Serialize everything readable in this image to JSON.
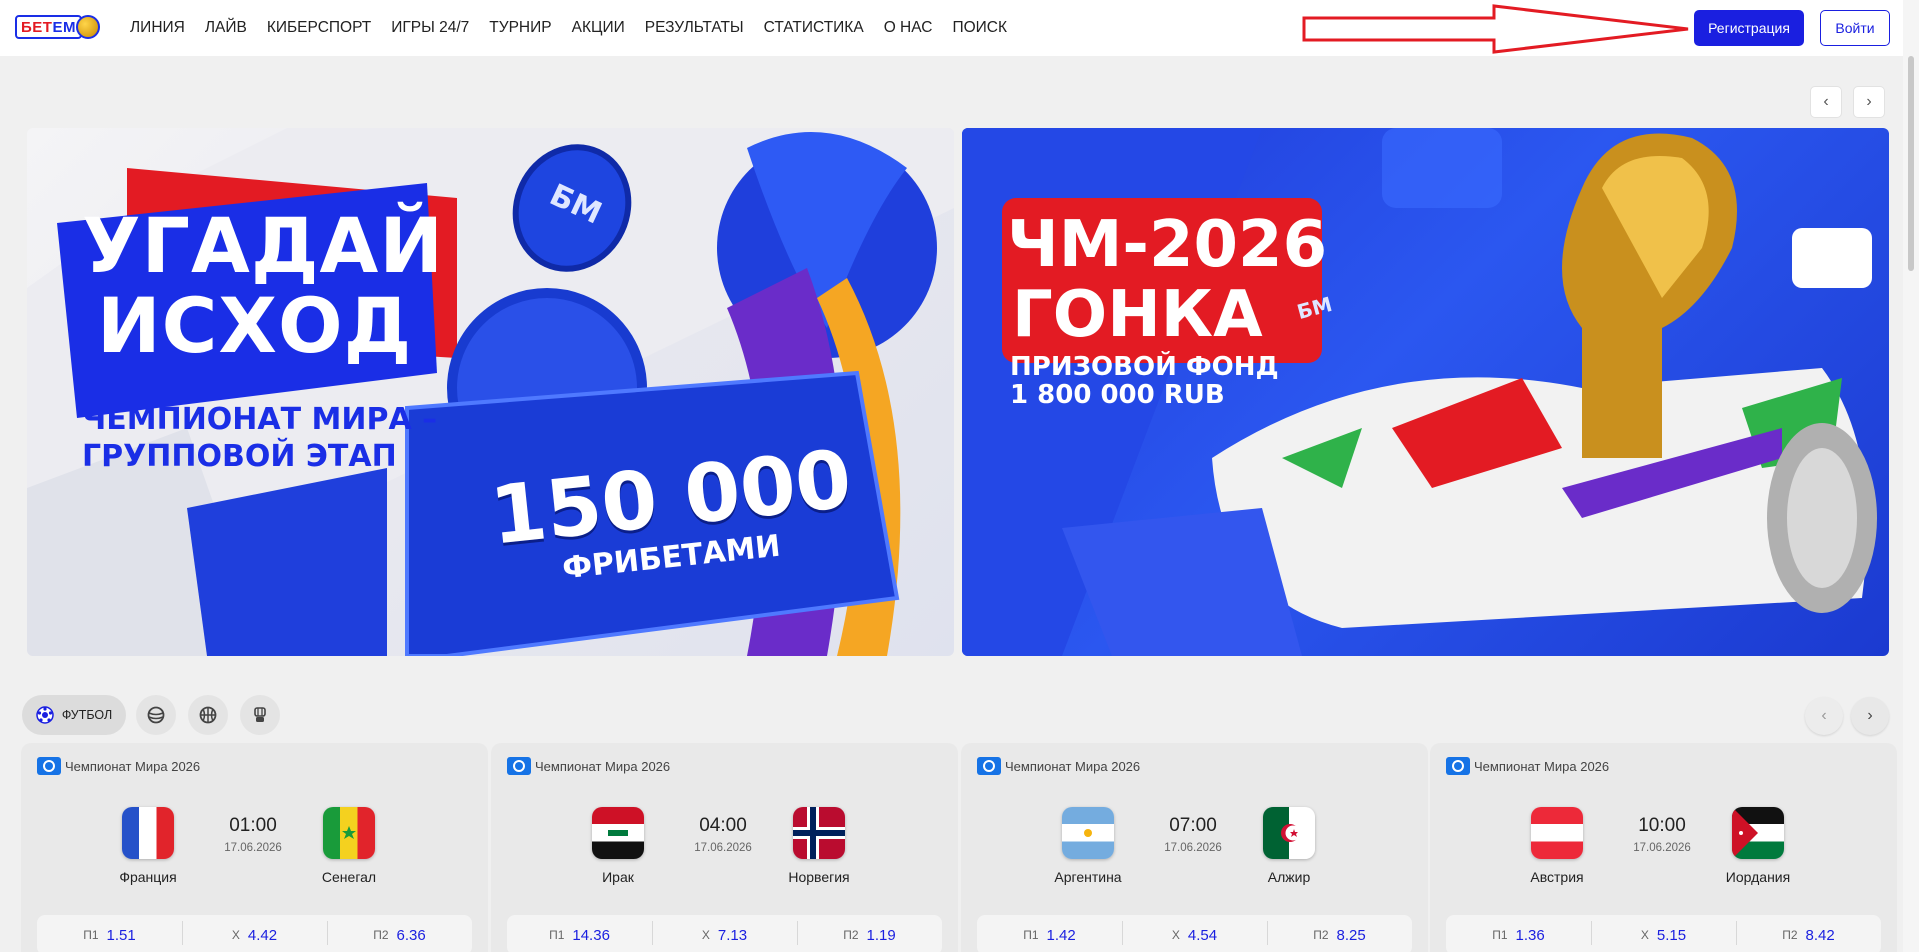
{
  "header": {
    "logo": {
      "part1": "БЕТ",
      "part2": "ЕМ"
    },
    "nav": [
      "Линия",
      "Лайв",
      "Киберспорт",
      "Игры 24/7",
      "Турнир",
      "Акции",
      "Результаты",
      "Статистика",
      "О нас",
      "Поиск"
    ],
    "register_label": "Регистрация",
    "login_label": "Войти"
  },
  "banners": [
    {
      "title_line1": "Угадай",
      "title_line2": "исход",
      "subtitle_line1": "Чемпионат мира –",
      "subtitle_line2": "групповой этап",
      "ticket_amount": "150 000",
      "ticket_text": "Фрибетами",
      "badge": "БМ"
    },
    {
      "title_line1": "ЧМ-2026",
      "title_line2": "Гонка",
      "subtitle_line1": "Призовой фонд",
      "subtitle_line2": "1 800 000 RUB",
      "badge": "БМ"
    }
  ],
  "banner_nav": {
    "prev": "‹",
    "next": "›"
  },
  "sports": {
    "active_label": "Футбол",
    "icons": [
      "soccer-icon",
      "tennis-icon",
      "basketball-icon",
      "hockey-icon"
    ]
  },
  "matches_nav": {
    "prev": "‹",
    "next": "›"
  },
  "matches": [
    {
      "league": "Чемпионат Мира 2026",
      "home": "Франция",
      "away": "Сенегал",
      "time": "01:00",
      "date": "17.06.2026",
      "odds": [
        {
          "label": "П1",
          "value": "1.51"
        },
        {
          "label": "Х",
          "value": "4.42"
        },
        {
          "label": "П2",
          "value": "6.36"
        }
      ]
    },
    {
      "league": "Чемпионат Мира 2026",
      "home": "Ирак",
      "away": "Норвегия",
      "time": "04:00",
      "date": "17.06.2026",
      "odds": [
        {
          "label": "П1",
          "value": "14.36"
        },
        {
          "label": "Х",
          "value": "7.13"
        },
        {
          "label": "П2",
          "value": "1.19"
        }
      ]
    },
    {
      "league": "Чемпионат Мира 2026",
      "home": "Аргентина",
      "away": "Алжир",
      "time": "07:00",
      "date": "17.06.2026",
      "odds": [
        {
          "label": "П1",
          "value": "1.42"
        },
        {
          "label": "Х",
          "value": "4.54"
        },
        {
          "label": "П2",
          "value": "8.25"
        }
      ]
    },
    {
      "league": "Чемпионат Мира 2026",
      "home": "Австрия",
      "away": "Иордания",
      "time": "10:00",
      "date": "17.06.2026",
      "odds": [
        {
          "label": "П1",
          "value": "1.36"
        },
        {
          "label": "Х",
          "value": "5.15"
        },
        {
          "label": "П2",
          "value": "8.42"
        }
      ]
    }
  ],
  "colors": {
    "accent": "#1a1fe0",
    "brand_red": "#e31b23",
    "odds_value": "#1a1fe0"
  }
}
